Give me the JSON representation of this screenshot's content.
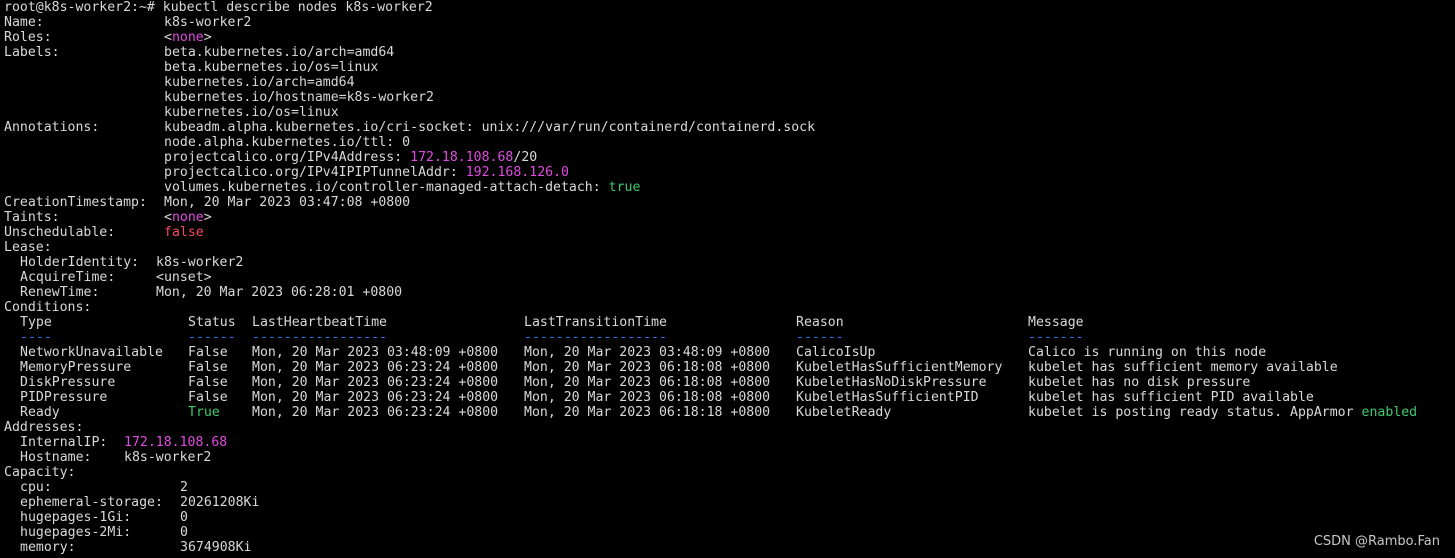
{
  "colors": {
    "background": "#000000",
    "foreground": "#d9d9d9",
    "magenta": "#e04be0",
    "red": "#f04a5a",
    "green": "#3ec96f",
    "blue_dashes": "#3b78ff"
  },
  "terminal": {
    "lines": [
      [
        {
          "text": "root@k8s-worker2:~# kubectl describe nodes k8s-worker2"
        }
      ],
      [
        {
          "text": "Name:"
        },
        {
          "text": "k8s-worker2",
          "col": 164
        }
      ],
      [
        {
          "text": "Roles:"
        },
        {
          "text": "<",
          "col": 164
        },
        {
          "text": "none",
          "color": "magenta"
        },
        {
          "text": ">"
        }
      ],
      [
        {
          "text": "Labels:"
        },
        {
          "text": "beta.kubernetes.io/arch=amd64",
          "col": 164
        }
      ],
      [
        {
          "text": "beta.kubernetes.io/os=linux",
          "col": 164
        }
      ],
      [
        {
          "text": "kubernetes.io/arch=amd64",
          "col": 164
        }
      ],
      [
        {
          "text": "kubernetes.io/hostname=k8s-worker2",
          "col": 164
        }
      ],
      [
        {
          "text": "kubernetes.io/os=linux",
          "col": 164
        }
      ],
      [
        {
          "text": "Annotations:"
        },
        {
          "text": "kubeadm.alpha.kubernetes.io/cri-socket: unix:///var/run/containerd/containerd.sock",
          "col": 164
        }
      ],
      [
        {
          "text": "node.alpha.kubernetes.io/ttl: 0",
          "col": 164
        }
      ],
      [
        {
          "text": "projectcalico.org/IPv4Address: ",
          "col": 164
        },
        {
          "text": "172.18.108.68",
          "color": "magenta"
        },
        {
          "text": "/20"
        }
      ],
      [
        {
          "text": "projectcalico.org/IPv4IPIPTunnelAddr: ",
          "col": 164
        },
        {
          "text": "192.168.126.0",
          "color": "magenta"
        }
      ],
      [
        {
          "text": "volumes.kubernetes.io/controller-managed-attach-detach: ",
          "col": 164
        },
        {
          "text": "true",
          "color": "green"
        }
      ],
      [
        {
          "text": "CreationTimestamp:"
        },
        {
          "text": "Mon, 20 Mar 2023 03:47:08 +0800",
          "col": 164
        }
      ],
      [
        {
          "text": "Taints:"
        },
        {
          "text": "<",
          "col": 164
        },
        {
          "text": "none",
          "color": "magenta"
        },
        {
          "text": ">"
        }
      ],
      [
        {
          "text": "Unschedulable:"
        },
        {
          "text": "false",
          "col": 164,
          "color": "red"
        }
      ],
      [
        {
          "text": "Lease:"
        }
      ],
      [
        {
          "text": "HolderIdentity:",
          "col": 20
        },
        {
          "text": "k8s-worker2",
          "col": 156
        }
      ],
      [
        {
          "text": "AcquireTime:",
          "col": 20
        },
        {
          "text": "<unset>",
          "col": 156
        }
      ],
      [
        {
          "text": "RenewTime:",
          "col": 20
        },
        {
          "text": "Mon, 20 Mar 2023 06:28:01 +0800",
          "col": 156
        }
      ],
      [
        {
          "text": "Conditions:"
        }
      ],
      [
        {
          "text": "Type",
          "col": 20
        },
        {
          "text": "Status",
          "col": 188
        },
        {
          "text": "LastHeartbeatTime",
          "col": 252
        },
        {
          "text": "LastTransitionTime",
          "col": 524
        },
        {
          "text": "Reason",
          "col": 796
        },
        {
          "text": "Message",
          "col": 1028
        }
      ],
      [
        {
          "text": "----",
          "col": 20,
          "color": "blue"
        },
        {
          "text": "------",
          "col": 188,
          "color": "blue"
        },
        {
          "text": "-----------------",
          "col": 252,
          "color": "blue"
        },
        {
          "text": "------------------",
          "col": 524,
          "color": "blue"
        },
        {
          "text": "------",
          "col": 796,
          "color": "blue"
        },
        {
          "text": "-------",
          "col": 1028,
          "color": "blue"
        }
      ],
      [
        {
          "text": "NetworkUnavailable",
          "col": 20
        },
        {
          "text": "False",
          "col": 188
        },
        {
          "text": "Mon, 20 Mar 2023 03:48:09 +0800",
          "col": 252
        },
        {
          "text": "Mon, 20 Mar 2023 03:48:09 +0800",
          "col": 524
        },
        {
          "text": "CalicoIsUp",
          "col": 796
        },
        {
          "text": "Calico is running on this node",
          "col": 1028
        }
      ],
      [
        {
          "text": "MemoryPressure",
          "col": 20
        },
        {
          "text": "False",
          "col": 188
        },
        {
          "text": "Mon, 20 Mar 2023 06:23:24 +0800",
          "col": 252
        },
        {
          "text": "Mon, 20 Mar 2023 06:18:08 +0800",
          "col": 524
        },
        {
          "text": "KubeletHasSufficientMemory",
          "col": 796
        },
        {
          "text": "kubelet has sufficient memory available",
          "col": 1028
        }
      ],
      [
        {
          "text": "DiskPressure",
          "col": 20
        },
        {
          "text": "False",
          "col": 188
        },
        {
          "text": "Mon, 20 Mar 2023 06:23:24 +0800",
          "col": 252
        },
        {
          "text": "Mon, 20 Mar 2023 06:18:08 +0800",
          "col": 524
        },
        {
          "text": "KubeletHasNoDiskPressure",
          "col": 796
        },
        {
          "text": "kubelet has no disk pressure",
          "col": 1028
        }
      ],
      [
        {
          "text": "PIDPressure",
          "col": 20
        },
        {
          "text": "False",
          "col": 188
        },
        {
          "text": "Mon, 20 Mar 2023 06:23:24 +0800",
          "col": 252
        },
        {
          "text": "Mon, 20 Mar 2023 06:18:08 +0800",
          "col": 524
        },
        {
          "text": "KubeletHasSufficientPID",
          "col": 796
        },
        {
          "text": "kubelet has sufficient PID available",
          "col": 1028
        }
      ],
      [
        {
          "text": "Ready",
          "col": 20
        },
        {
          "text": "True",
          "col": 188,
          "color": "green"
        },
        {
          "text": "Mon, 20 Mar 2023 06:23:24 +0800",
          "col": 252
        },
        {
          "text": "Mon, 20 Mar 2023 06:18:18 +0800",
          "col": 524
        },
        {
          "text": "KubeletReady",
          "col": 796
        },
        {
          "text": "kubelet is posting ready status. AppArmor ",
          "col": 1028
        },
        {
          "text": "enabled",
          "color": "green"
        }
      ],
      [
        {
          "text": "Addresses:"
        }
      ],
      [
        {
          "text": "InternalIP:",
          "col": 20
        },
        {
          "text": "172.18.108.68",
          "col": 124,
          "color": "magenta"
        }
      ],
      [
        {
          "text": "Hostname:",
          "col": 20
        },
        {
          "text": "k8s-worker2",
          "col": 124
        }
      ],
      [
        {
          "text": "Capacity:"
        }
      ],
      [
        {
          "text": "cpu:",
          "col": 20
        },
        {
          "text": "2",
          "col": 180
        }
      ],
      [
        {
          "text": "ephemeral-storage:",
          "col": 20
        },
        {
          "text": "20261208Ki",
          "col": 180
        }
      ],
      [
        {
          "text": "hugepages-1Gi:",
          "col": 20
        },
        {
          "text": "0",
          "col": 180
        }
      ],
      [
        {
          "text": "hugepages-2Mi:",
          "col": 20
        },
        {
          "text": "0",
          "col": 180
        }
      ],
      [
        {
          "text": "memory:",
          "col": 20
        },
        {
          "text": "3674908Ki",
          "col": 180
        }
      ]
    ]
  },
  "watermark": "CSDN @Rambo.Fan"
}
